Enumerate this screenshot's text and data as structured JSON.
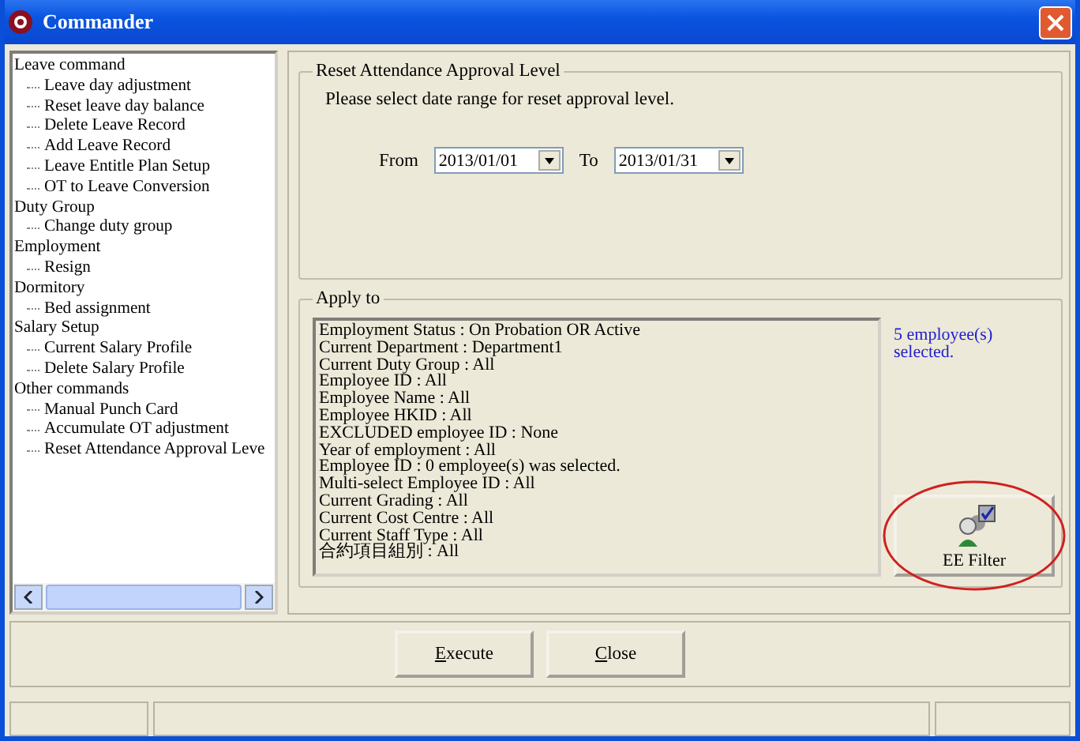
{
  "window": {
    "title": "Commander"
  },
  "tree": [
    {
      "label": "Leave command",
      "children": [
        {
          "label": "Leave day adjustment"
        },
        {
          "label": "Reset leave day balance"
        },
        {
          "label": "Delete Leave Record"
        },
        {
          "label": "Add Leave Record"
        },
        {
          "label": "Leave Entitle Plan Setup"
        },
        {
          "label": "OT to Leave Conversion"
        }
      ]
    },
    {
      "label": "Duty Group",
      "children": [
        {
          "label": "Change duty group"
        }
      ]
    },
    {
      "label": "Employment",
      "children": [
        {
          "label": "Resign"
        }
      ]
    },
    {
      "label": "Dormitory",
      "children": [
        {
          "label": "Bed assignment"
        }
      ]
    },
    {
      "label": "Salary Setup",
      "children": [
        {
          "label": "Current Salary Profile"
        },
        {
          "label": "Delete Salary Profile"
        }
      ]
    },
    {
      "label": "Other commands",
      "children": [
        {
          "label": "Manual Punch Card"
        },
        {
          "label": "Accumulate OT adjustment"
        },
        {
          "label": "Reset Attendance Approval Leve"
        }
      ]
    }
  ],
  "reset_group": {
    "title": "Reset Attendance Approval Level",
    "instruction": "Please select date range for reset approval level.",
    "from_label": "From",
    "from_value": "2013/01/01",
    "to_label": "To",
    "to_value": "2013/01/31"
  },
  "apply_group": {
    "title": "Apply to",
    "criteria": [
      "Employment Status : On Probation OR Active",
      "Current Department : Department1",
      "Current Duty Group : All",
      "Employee ID : All",
      "Employee Name : All",
      "Employee HKID : All",
      "EXCLUDED employee ID : None",
      "Year of employment : All",
      "Employee ID : 0 employee(s) was selected.",
      "Multi-select Employee ID : All",
      "Current Grading : All",
      "Current Cost Centre : All",
      "Current Staff Type : All",
      "合約項目組別 : All"
    ],
    "selected_count": "5 employee(s) selected.",
    "filter_button": "EE Filter"
  },
  "buttons": [
    "Execute",
    "Close"
  ]
}
